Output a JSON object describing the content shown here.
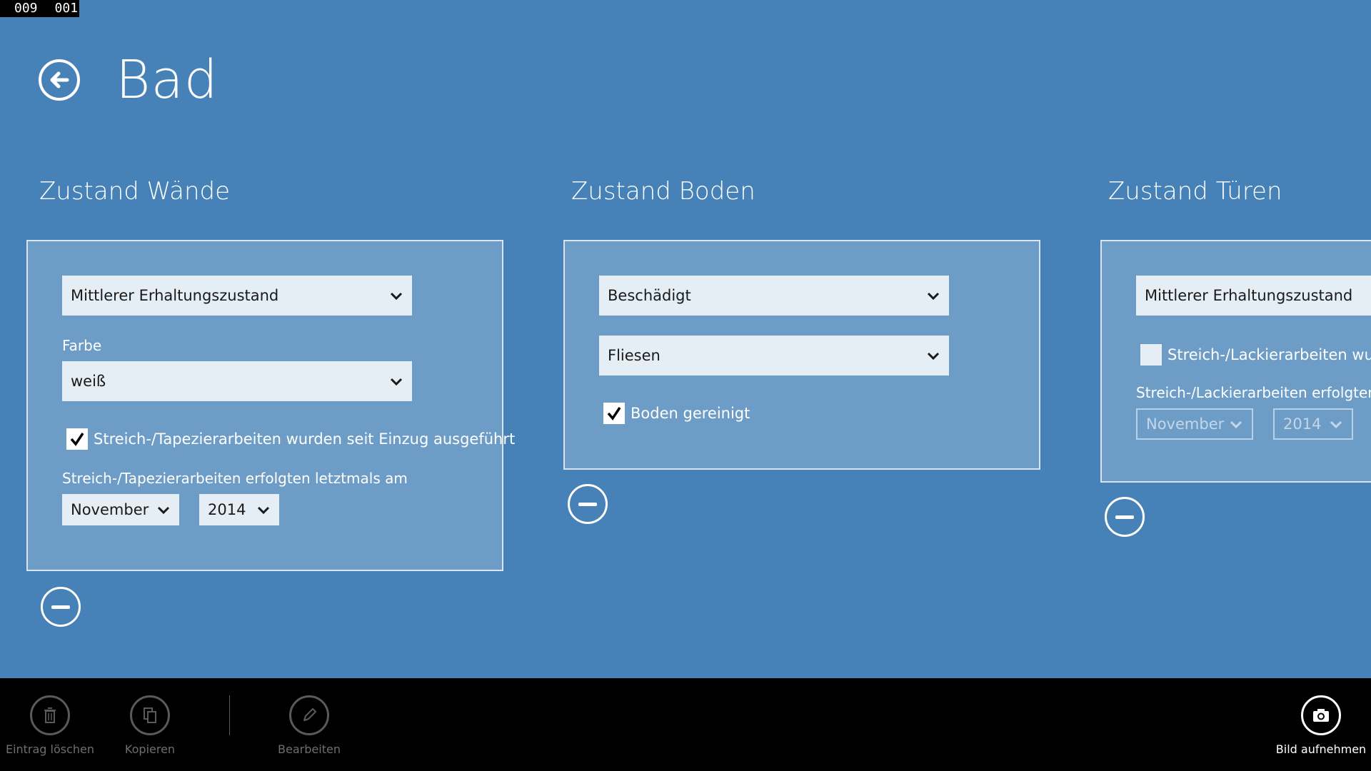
{
  "debug": {
    "a": "009",
    "b": "001"
  },
  "page_title": "Bad",
  "sections": {
    "walls": {
      "title": "Zustand Wände",
      "condition": "Mittlerer Erhaltungszustand",
      "color_label": "Farbe",
      "color": "weiß",
      "painted_label": "Streich-/Tapezierarbeiten wurden seit Einzug ausgeführt",
      "painted_checked": true,
      "last_label": "Streich-/Tapezierarbeiten erfolgten letztmals am",
      "month": "November",
      "year": "2014"
    },
    "floor": {
      "title": "Zustand Boden",
      "condition": "Beschädigt",
      "material": "Fliesen",
      "cleaned_label": "Boden gereinigt",
      "cleaned_checked": true
    },
    "doors": {
      "title": "Zustand Türen",
      "condition": "Mittlerer Erhaltungszustand",
      "painted_label": "Streich-/Lackierarbeiten wurden",
      "painted_checked": false,
      "last_label": "Streich-/Lackierarbeiten erfolgten letz",
      "month": "November",
      "year": "2014"
    }
  },
  "app_bar": {
    "delete_label": "Eintrag löschen",
    "copy_label": "Kopieren",
    "edit_label": "Bearbeiten",
    "photo_label": "Bild aufnehmen"
  },
  "colors": {
    "background": "#4682b7",
    "panel": "#6d9dc6",
    "app_bar": "#000000"
  }
}
